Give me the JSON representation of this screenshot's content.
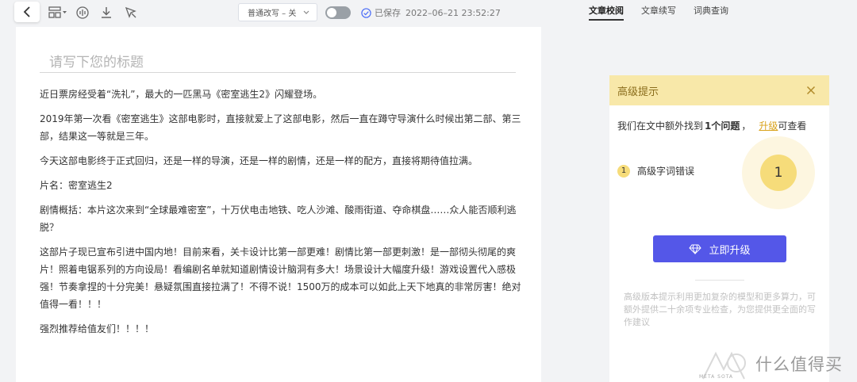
{
  "toolbar": {
    "mode_select": "普通改写 – 关",
    "saved_label": "已保存",
    "saved_time": "2022–06–21 23:52:27"
  },
  "tabs": [
    {
      "label": "文章校阅",
      "active": true
    },
    {
      "label": "文章续写",
      "active": false
    },
    {
      "label": "词典查询",
      "active": false
    }
  ],
  "editor": {
    "title_placeholder": "请写下您的标题",
    "paragraphs": [
      "近日票房经受着“洗礼”，最大的一匹黑马《密室逃生2》闪耀登场。",
      "2019年第一次看《密室逃生》这部电影时，直接就爱上了这部电影，然后一直在蹲守导演什么时候出第二部、第三部，结果这一等就是三年。",
      "今天这部电影终于正式回归，还是一样的导演，还是一样的剧情，还是一样的配方，直接将期待值拉满。",
      "片名：密室逃生2",
      "剧情概括：本片这次来到“全球最难密室”，十万伏电击地铁、吃人沙滩、酸雨街道、夺命棋盘……众人能否顺利逃脱？",
      "这部片子现已宣布引进中国内地！目前来看，关卡设计比第一部更难！剧情比第一部更刺激！是一部彻头彻尾的爽片！照着电锯系列的方向设局！看编剧名单就知道剧情设计脑洞有多大！场景设计大幅度升级！游戏设置代入感极强！节奏拿捏的十分完美！悬疑氛围直接拉满了！不得不说！1500万的成本可以如此上天下地真的非常厉害！绝对值得一看！！！",
      "强烈推荐给值友们！！！！"
    ]
  },
  "hint_panel": {
    "title": "高级提示",
    "found_prefix": "我们在文中额外找到",
    "found_count": "1个问题",
    "found_sep": "，",
    "upgrade_link": "升级",
    "found_suffix": "可查看",
    "issues": [
      {
        "num": "1",
        "label": "高级字词错误"
      }
    ],
    "big_count": "1",
    "upgrade_button": "立即升级",
    "description": "高级版本提示利用更加复杂的模型和更多算力，可额外提供二十余项专业检查，为您提供更全面的写作建议"
  },
  "watermark": {
    "brand_text": "什么值得买",
    "meta_text": "META SOTA"
  },
  "colors": {
    "accent": "#5457e8",
    "hint_header_bg": "#f8e8a9",
    "hint_yellow": "#f6dc7a",
    "link_color": "#d9a21b"
  }
}
